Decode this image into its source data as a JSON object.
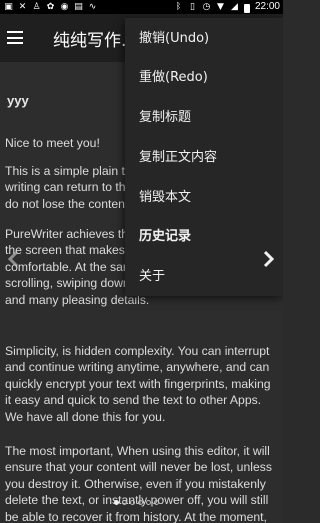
{
  "status_bar": {
    "time": "22:00",
    "left_icons": [
      "notification-icon",
      "notification-icon",
      "notification-icon",
      "notification-icon",
      "notification-icon",
      "notification-icon",
      "activity-icon"
    ],
    "right_icons": [
      "bluetooth-icon",
      "vibrate-icon",
      "alarm-icon",
      "wifi-icon",
      "signal-icon",
      "battery-icon"
    ]
  },
  "toolbar": {
    "title": "纯纯写作.",
    "menu_icon": "hamburger-icon"
  },
  "document": {
    "title": "yyy",
    "paragraphs": [
      "Nice to meet you!",
      "This is a simple plain text editor, every time your writing can return to the state you left it last time, do not lose the content.",
      "PureWriter achieves the best fragment spacing on the screen that makes your text look more comfortable. At the same time, it also has smooth scrolling, swiping down to close the soft keyboard, and many pleasing details.",
      "Simplicity, is hidden complexity. You can interrupt and continue writing anytime, anywhere, and can quickly encrypt your text with fingerprints, making it easy and quick to send the text to other Apps. We have all done this for you.",
      "The most important, When using this editor, it will ensure that your content will never be lost, unless you destroy it. Otherwise, even if you mistakenly delete the text, or instantly power off, you will still be able to recover it from history. At the moment,"
    ]
  },
  "pager": {
    "total_pages": 6,
    "active_index": 0
  },
  "menu": {
    "items": [
      {
        "label": "撤销(Undo)",
        "bold": false
      },
      {
        "label": "重做(Redo)",
        "bold": false
      },
      {
        "label": "复制标题",
        "bold": false
      },
      {
        "label": "复制正文内容",
        "bold": false
      },
      {
        "label": "销毁本文",
        "bold": false
      },
      {
        "label": "历史记录",
        "bold": true
      },
      {
        "label": "关于",
        "bold": false
      }
    ]
  },
  "colors": {
    "background": "#2d2d2d",
    "toolbar": "#1f1f1f",
    "menu": "#262626",
    "text": "#dcdcdc"
  }
}
